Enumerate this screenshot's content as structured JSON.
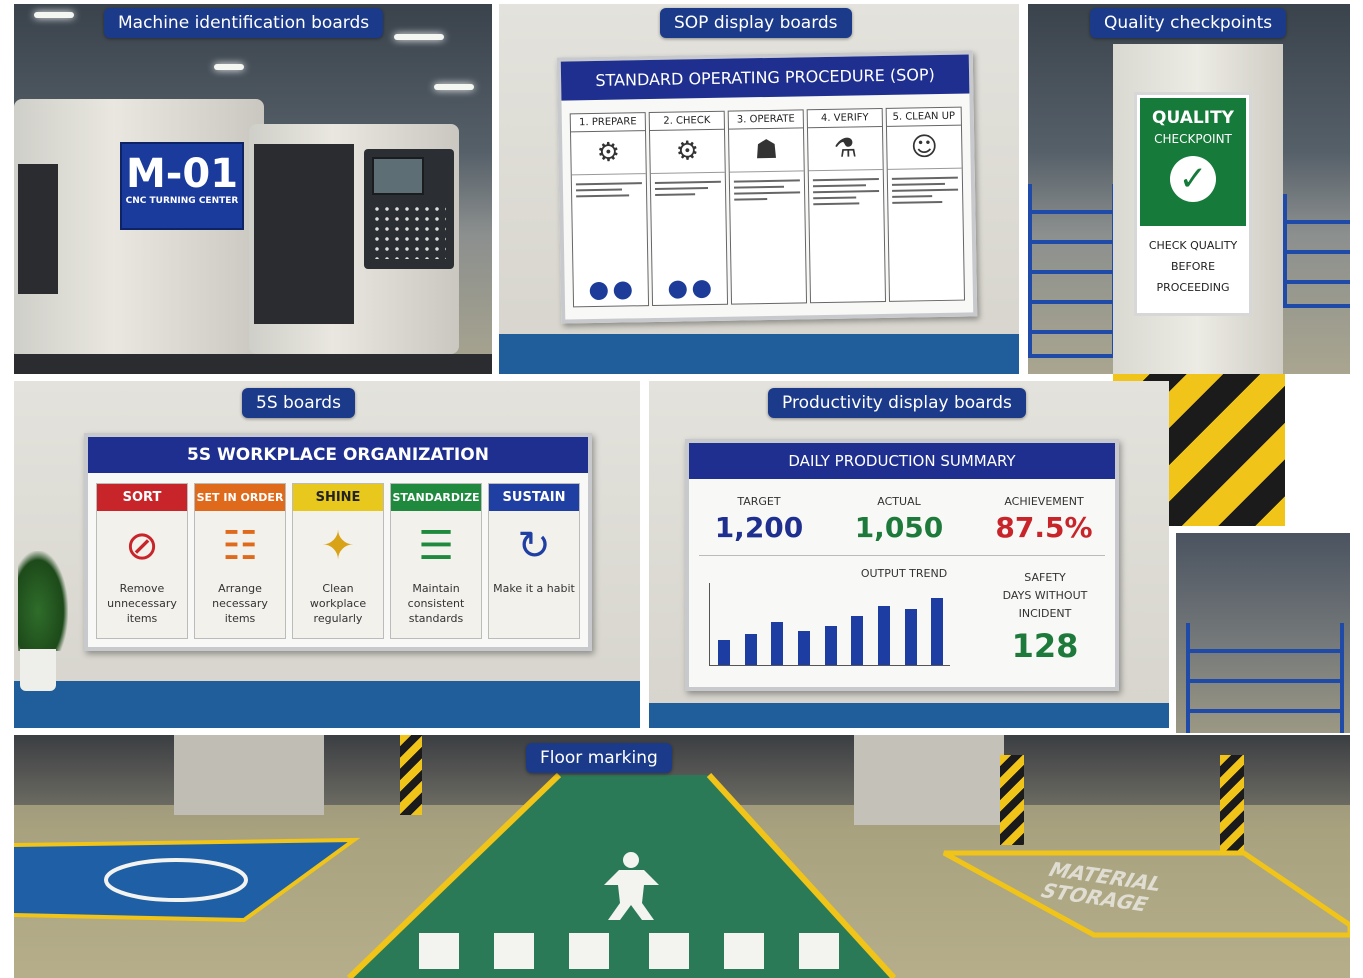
{
  "panels": {
    "machine": {
      "tag": "Machine identification boards",
      "sign_id": "M-01",
      "sign_sub": "CNC TURNING CENTER"
    },
    "sop": {
      "tag": "SOP display boards",
      "title": "STANDARD OPERATING PROCEDURE (SOP)",
      "steps": [
        "1. PREPARE",
        "2. CHECK",
        "3. OPERATE",
        "4. VERIFY",
        "5. CLEAN UP"
      ]
    },
    "quality": {
      "tag": "Quality checkpoints",
      "head": "QUALITY",
      "sub": "CHECKPOINT",
      "line1": "CHECK QUALITY",
      "line2": "BEFORE",
      "line3": "PROCEEDING"
    },
    "fives": {
      "tag": "5S boards",
      "title": "5S WORKPLACE ORGANIZATION",
      "items": [
        {
          "name": "SORT",
          "desc": "Remove unnecessary items",
          "color": "#c8252b"
        },
        {
          "name": "SET IN ORDER",
          "desc": "Arrange necessary items",
          "color": "#e06a1c"
        },
        {
          "name": "SHINE",
          "desc": "Clean workplace regularly",
          "color": "#e8c81d"
        },
        {
          "name": "STANDARDIZE",
          "desc": "Maintain consistent standards",
          "color": "#1f8a3e"
        },
        {
          "name": "SUSTAIN",
          "desc": "Make it a habit",
          "color": "#1f3fa3"
        }
      ]
    },
    "productivity": {
      "tag": "Productivity display boards",
      "title": "DAILY PRODUCTION SUMMARY",
      "target_label": "TARGET",
      "target_value": "1,200",
      "actual_label": "ACTUAL",
      "actual_value": "1,050",
      "achievement_label": "ACHIEVEMENT",
      "achievement_value": "87.5%",
      "trend_label": "OUTPUT TREND",
      "safety_label1": "SAFETY",
      "safety_label2": "DAYS WITHOUT",
      "safety_label3": "INCIDENT",
      "safety_value": "128",
      "trend_bars": [
        0.3,
        0.38,
        0.52,
        0.42,
        0.48,
        0.6,
        0.72,
        0.68,
        0.82
      ]
    },
    "floor": {
      "tag": "Floor marking",
      "storage_line1": "MATERIAL",
      "storage_line2": "STORAGE"
    }
  },
  "colors": {
    "tag_bg": "#1c3a8a",
    "board_head": "#1e2f8f",
    "floor_walkway": "#2a7a57",
    "floor_line": "#f0c419"
  }
}
